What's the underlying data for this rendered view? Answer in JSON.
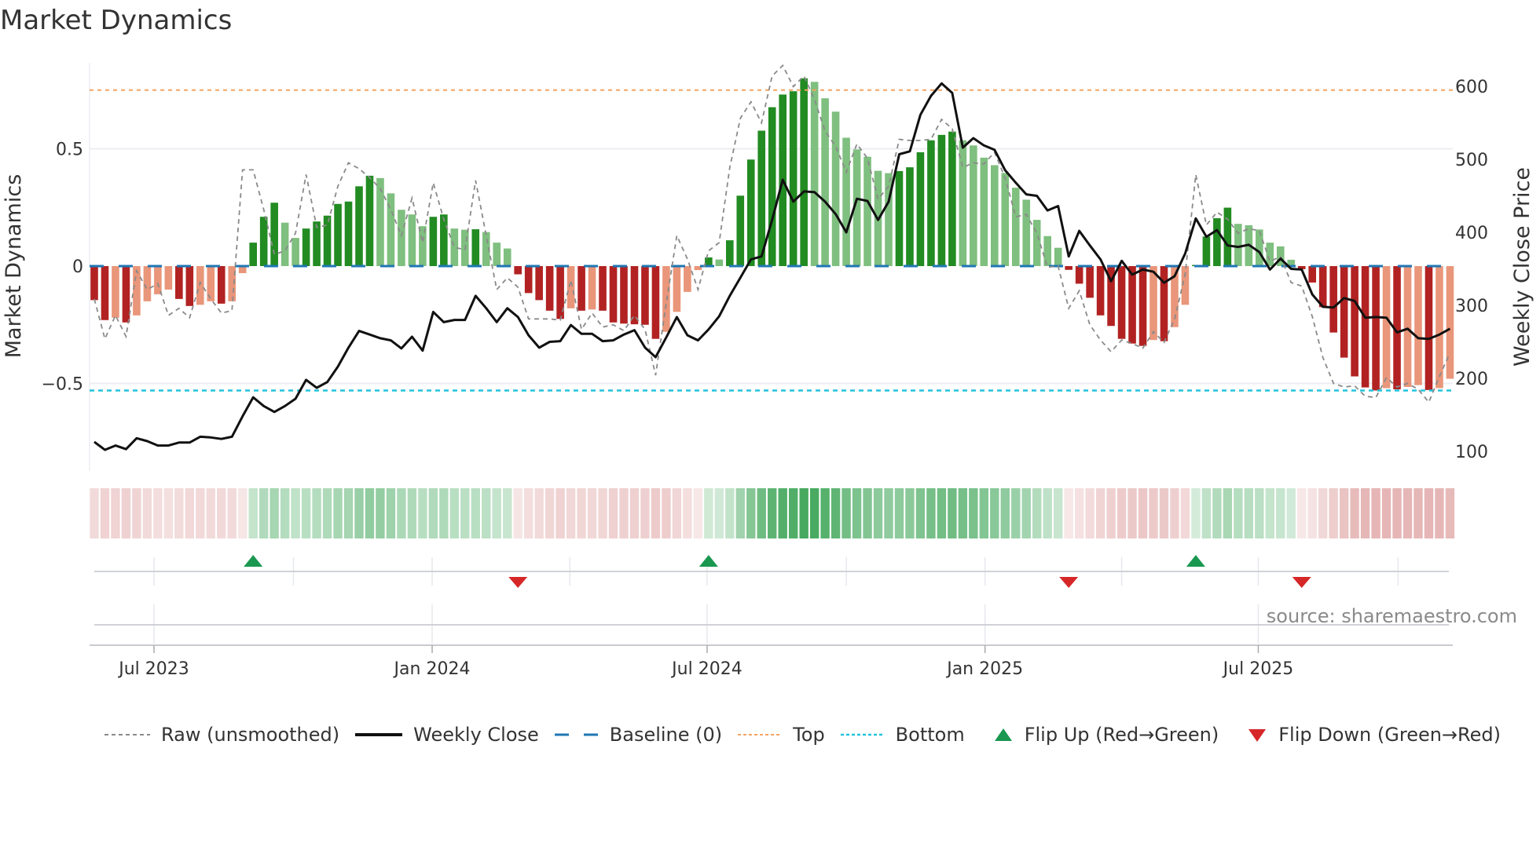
{
  "title": "Market Dynamics",
  "source": "source: sharemaestro.com",
  "colors": {
    "pos_strong": "#228b22",
    "pos_weak": "#7fbf7f",
    "neg_strong": "#b22222",
    "neg_weak": "#e9967a",
    "raw": "#8a8a8a",
    "close": "#111111",
    "baseline": "#1f77b4",
    "top": "#f4a460",
    "bottom": "#22c4dc",
    "flip_up": "#1a9850",
    "flip_down": "#d62728"
  },
  "legend": {
    "raw": "Raw (unsmoothed)",
    "close": "Weekly Close",
    "baseline": "Baseline (0)",
    "top": "Top",
    "bottom": "Bottom",
    "flip_up": "Flip Up (Red→Green)",
    "flip_down": "Flip Down (Green→Red)"
  },
  "chart_data": {
    "type": "bar",
    "title": "Market Dynamics",
    "ylabel": "Market Dynamics",
    "y2label": "Weekly Close Price",
    "ylim": [
      -0.81,
      0.9
    ],
    "y2lim": [
      60,
      650
    ],
    "yticks": [
      {
        "v": 0.5,
        "label": "0.5"
      },
      {
        "v": 0,
        "label": "0"
      },
      {
        "v": -0.5,
        "label": "−0.5"
      }
    ],
    "y2ticks": [
      {
        "v": 600,
        "label": "600"
      },
      {
        "v": 500,
        "label": "500"
      },
      {
        "v": 400,
        "label": "400"
      },
      {
        "v": 300,
        "label": "300"
      },
      {
        "v": 200,
        "label": "200"
      },
      {
        "v": 100,
        "label": "100"
      }
    ],
    "xticks": [
      {
        "week": 6.64,
        "label": "Jul 2023"
      },
      {
        "week": 32.9,
        "label": "Jan 2024"
      },
      {
        "week": 58.86,
        "label": "Jul 2024"
      },
      {
        "week": 85.1,
        "label": "Jan 2025"
      },
      {
        "week": 110.9,
        "label": "Jul 2025"
      }
    ],
    "quarter_grid_weeks": [
      6.64,
      19.8,
      32.9,
      45.9,
      58.86,
      72.0,
      85.1,
      98.0,
      110.9,
      124.1
    ],
    "top_level": 0.75,
    "bottom_level": -0.53,
    "baseline": 0,
    "smoothed": [
      -0.145,
      -0.23,
      -0.22,
      -0.24,
      -0.21,
      -0.15,
      -0.12,
      -0.1,
      -0.14,
      -0.17,
      -0.165,
      -0.15,
      -0.16,
      -0.15,
      -0.03,
      0.1,
      0.21,
      0.27,
      0.185,
      0.12,
      0.16,
      0.19,
      0.215,
      0.265,
      0.275,
      0.34,
      0.385,
      0.375,
      0.31,
      0.24,
      0.22,
      0.17,
      0.21,
      0.22,
      0.16,
      0.155,
      0.157,
      0.145,
      0.1,
      0.075,
      -0.035,
      -0.115,
      -0.145,
      -0.19,
      -0.225,
      -0.18,
      -0.19,
      -0.185,
      -0.19,
      -0.24,
      -0.245,
      -0.248,
      -0.25,
      -0.31,
      -0.28,
      -0.195,
      -0.11,
      -0.017,
      0.037,
      0.028,
      0.11,
      0.3,
      0.454,
      0.577,
      0.677,
      0.731,
      0.745,
      0.8,
      0.785,
      0.715,
      0.658,
      0.547,
      0.497,
      0.466,
      0.406,
      0.396,
      0.405,
      0.421,
      0.485,
      0.536,
      0.559,
      0.573,
      0.536,
      0.514,
      0.462,
      0.43,
      0.397,
      0.334,
      0.283,
      0.197,
      0.128,
      0.078,
      -0.016,
      -0.075,
      -0.135,
      -0.21,
      -0.255,
      -0.31,
      -0.33,
      -0.34,
      -0.315,
      -0.32,
      -0.26,
      -0.165,
      0.005,
      0.126,
      0.204,
      0.249,
      0.18,
      0.174,
      0.156,
      0.1,
      0.084,
      0.027,
      -0.013,
      -0.07,
      -0.175,
      -0.283,
      -0.39,
      -0.47,
      -0.517,
      -0.53,
      -0.52,
      -0.525,
      -0.515,
      -0.507,
      -0.528,
      -0.52,
      -0.48
    ],
    "raw": [
      -0.14,
      -0.31,
      -0.21,
      -0.3,
      -0.02,
      -0.1,
      -0.075,
      -0.21,
      -0.18,
      -0.22,
      -0.07,
      -0.14,
      -0.2,
      -0.19,
      0.41,
      0.41,
      0.24,
      0.05,
      0.065,
      0.14,
      0.39,
      0.165,
      0.175,
      0.34,
      0.44,
      0.415,
      0.377,
      0.33,
      0.24,
      0.13,
      0.29,
      0.1,
      0.355,
      0.2,
      0.08,
      0.07,
      0.365,
      0.13,
      -0.1,
      -0.05,
      -0.09,
      -0.225,
      -0.225,
      -0.225,
      -0.23,
      -0.06,
      -0.27,
      -0.2,
      -0.26,
      -0.25,
      -0.275,
      -0.21,
      -0.27,
      -0.465,
      -0.16,
      0.13,
      0.03,
      -0.1,
      0.065,
      0.1,
      0.42,
      0.63,
      0.7,
      0.61,
      0.81,
      0.855,
      0.765,
      0.81,
      0.71,
      0.575,
      0.51,
      0.4,
      0.52,
      0.46,
      0.285,
      0.34,
      0.54,
      0.535,
      0.535,
      0.54,
      0.625,
      0.585,
      0.42,
      0.44,
      0.435,
      0.485,
      0.375,
      0.21,
      0.22,
      0.14,
      -0.005,
      0.0,
      -0.18,
      -0.105,
      -0.25,
      -0.315,
      -0.365,
      -0.315,
      -0.33,
      -0.35,
      -0.28,
      -0.325,
      -0.225,
      -0.035,
      0.39,
      0.175,
      0.23,
      0.2,
      0.14,
      0.16,
      0.15,
      0.02,
      0.04,
      -0.07,
      -0.085,
      -0.215,
      -0.39,
      -0.5,
      -0.515,
      -0.51,
      -0.555,
      -0.56,
      -0.475,
      -0.515,
      -0.5,
      -0.525,
      -0.58,
      -0.47,
      -0.37
    ],
    "weekly_close": [
      113,
      102,
      108,
      103,
      118,
      114,
      108,
      108,
      112,
      112,
      120,
      119,
      117,
      120,
      148,
      174,
      162,
      154,
      162,
      172,
      198,
      187,
      195,
      216,
      242,
      265,
      260,
      255,
      252,
      241,
      257,
      238,
      291,
      277,
      280,
      280,
      313,
      296,
      277,
      296,
      284,
      259,
      242,
      250,
      251,
      273,
      261,
      261,
      251,
      252,
      260,
      266,
      242,
      229,
      256,
      284,
      259,
      252,
      267,
      285,
      313,
      338,
      363,
      367,
      417,
      472,
      442,
      456,
      455,
      442,
      425,
      400,
      446,
      443,
      417,
      442,
      507,
      511,
      561,
      587,
      604,
      591,
      516,
      529,
      519,
      513,
      485,
      468,
      452,
      450,
      430,
      436,
      367,
      402,
      382,
      363,
      333,
      361,
      342,
      349,
      346,
      331,
      340,
      371,
      419,
      394,
      403,
      382,
      380,
      383,
      373,
      349,
      364,
      350,
      349,
      315,
      298,
      297,
      310,
      306,
      283,
      284,
      283,
      263,
      268,
      255,
      254,
      260,
      268
    ],
    "flip_up_weeks": [
      16,
      59,
      105
    ],
    "flip_down_weeks": [
      41,
      93,
      115
    ]
  }
}
